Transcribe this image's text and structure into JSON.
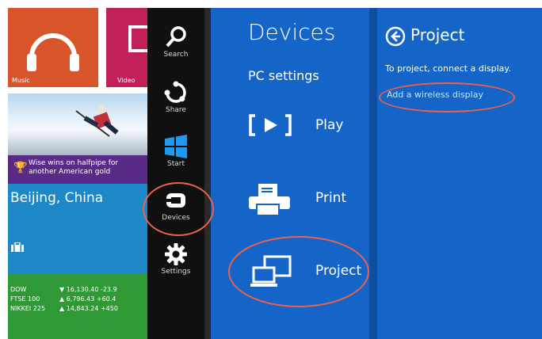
{
  "tiles": {
    "music_label": "Music",
    "video_label": "Video",
    "news_headline_1": "Wise wins on halfpipe for",
    "news_headline_2": "another American gold",
    "weather_city": "Beijing, China",
    "finance": [
      {
        "name": "DOW",
        "value": "▼ 16,130.40 -23.9"
      },
      {
        "name": "FTSE 100",
        "value": "▲ 6,796.43 +60.4"
      },
      {
        "name": "NIKKEI 225",
        "value": "▲ 14,843.24 +450"
      }
    ]
  },
  "charms": [
    {
      "label": "Search",
      "icon": "search-icon"
    },
    {
      "label": "Share",
      "icon": "share-icon"
    },
    {
      "label": "Start",
      "icon": "windows-logo-icon"
    },
    {
      "label": "Devices",
      "icon": "devices-icon"
    },
    {
      "label": "Settings",
      "icon": "gear-icon"
    }
  ],
  "devices_pane": {
    "title": "Devices",
    "pc_settings": "PC settings",
    "items": [
      {
        "label": "Play",
        "icon": "play-icon"
      },
      {
        "label": "Print",
        "icon": "printer-icon"
      },
      {
        "label": "Project",
        "icon": "project-icon"
      }
    ]
  },
  "project_pane": {
    "title": "Project",
    "hint": "To project, connect a display.",
    "link": "Add a wireless display"
  },
  "colors": {
    "pane_blue": "#1565c8",
    "charms_bg": "#101010",
    "annotation": "#e8624e"
  }
}
